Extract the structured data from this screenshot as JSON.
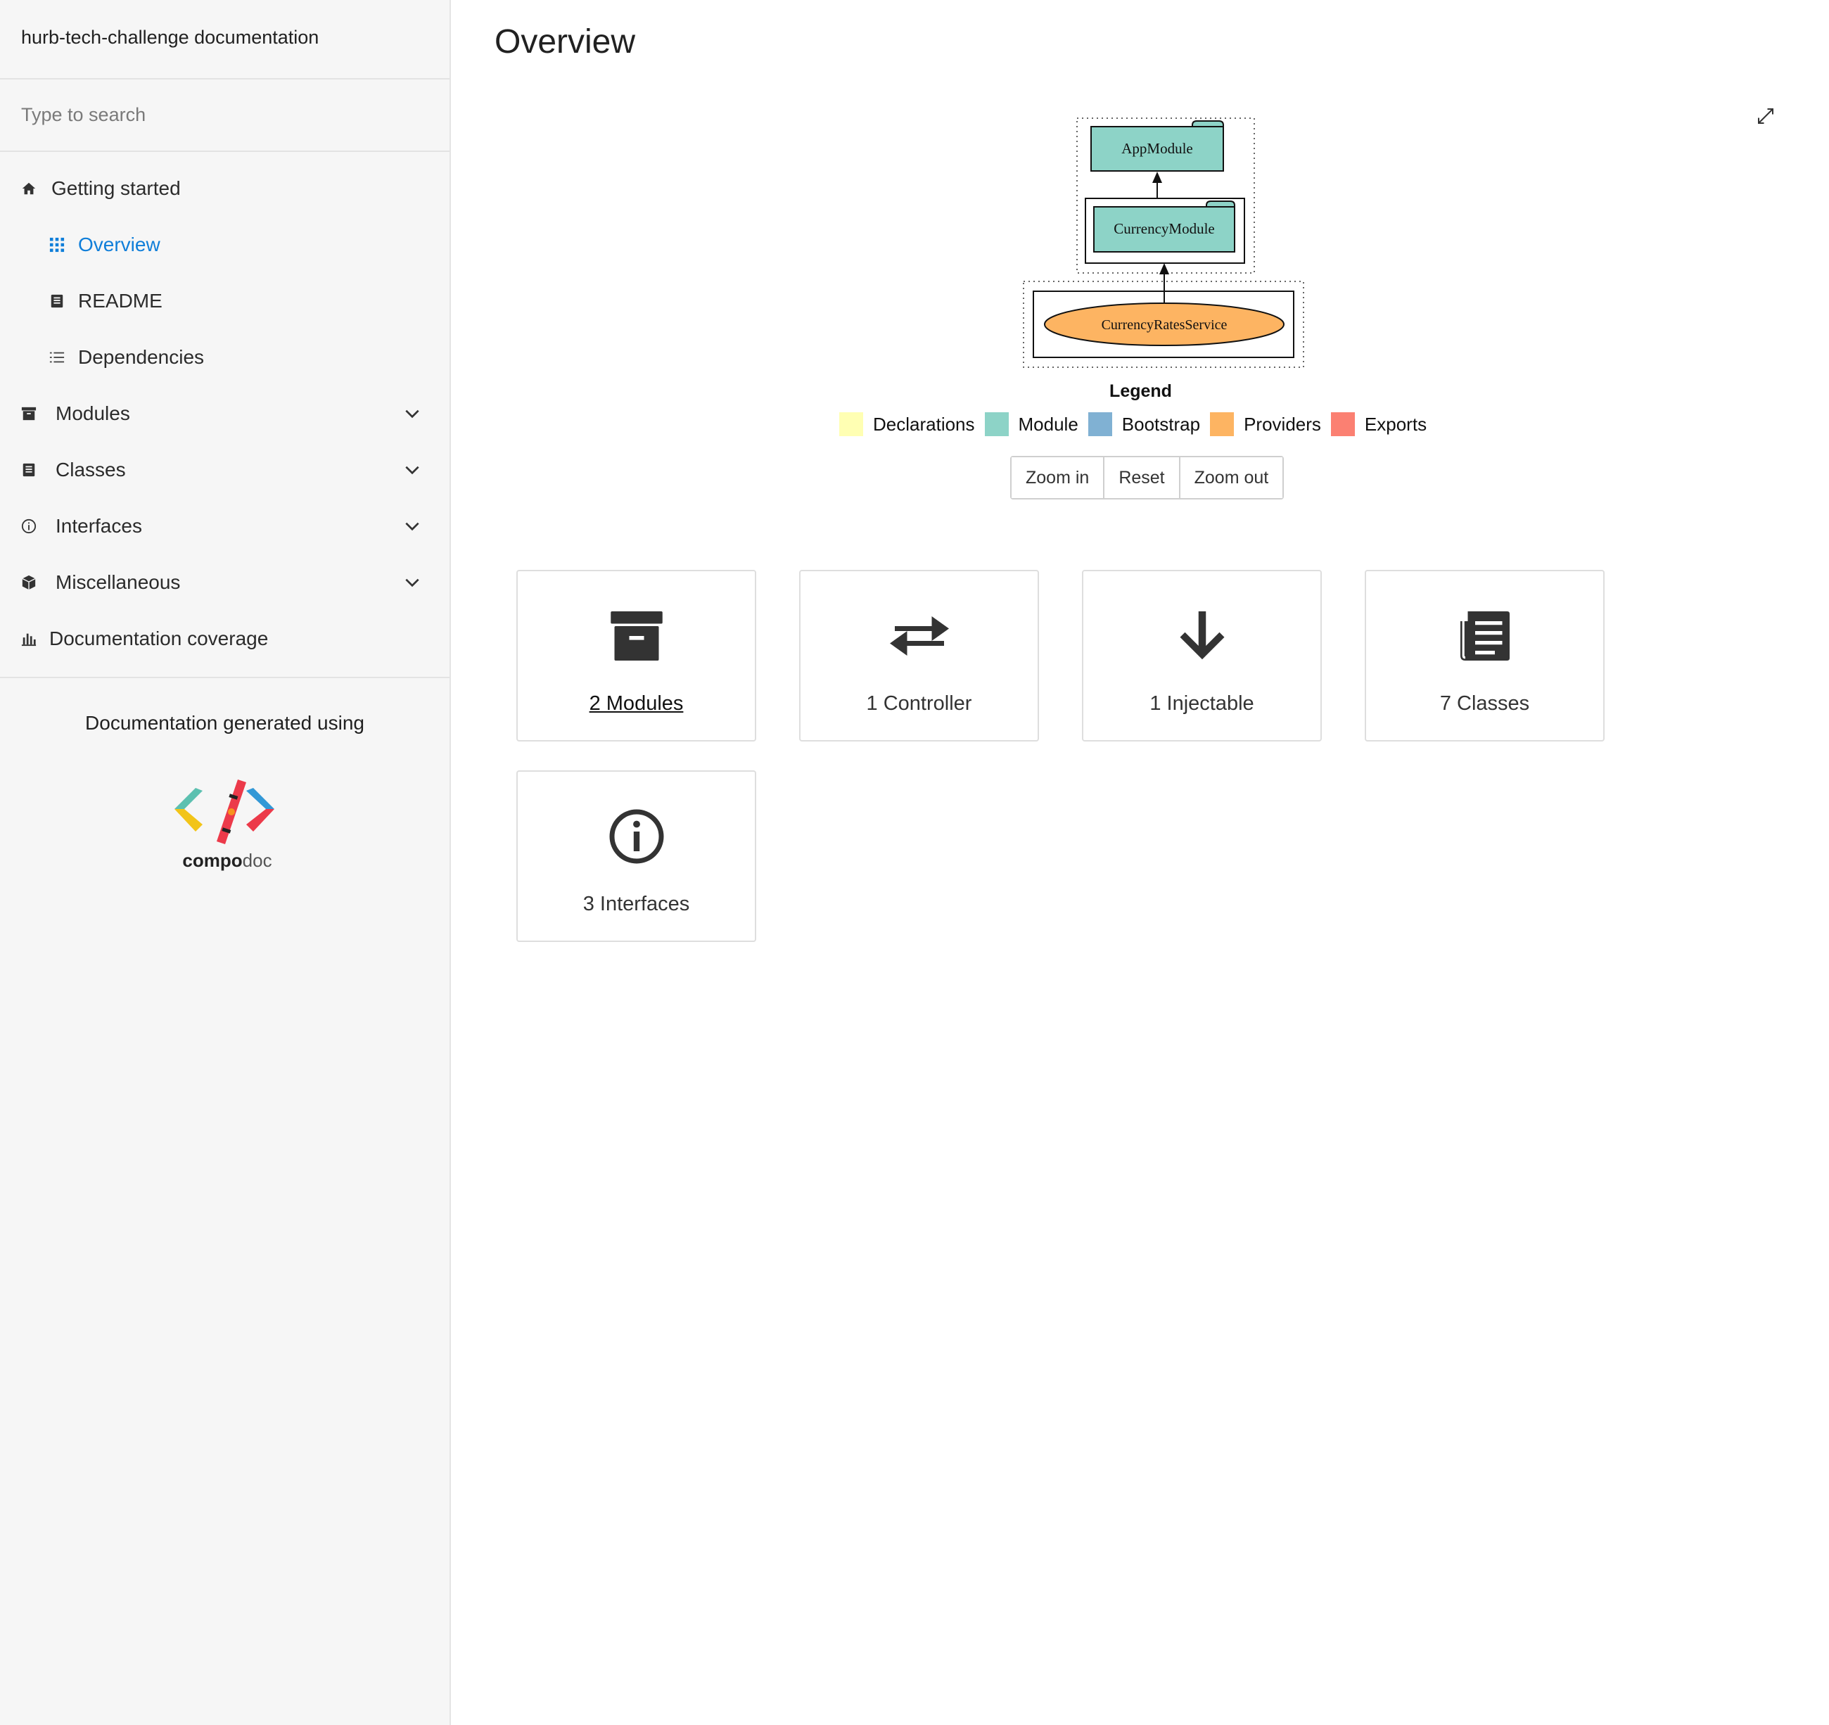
{
  "sidebar": {
    "title": "hurb-tech-challenge documentation",
    "search": {
      "placeholder": "Type to search",
      "value": ""
    },
    "menu": [
      {
        "label": "Getting started",
        "icon": "home-icon"
      },
      {
        "label": "Overview",
        "icon": "grid-icon",
        "active": true
      },
      {
        "label": "README",
        "icon": "book-icon"
      },
      {
        "label": "Dependencies",
        "icon": "list-icon"
      },
      {
        "label": "Modules",
        "icon": "archive-icon"
      },
      {
        "label": "Classes",
        "icon": "file-icon"
      },
      {
        "label": "Interfaces",
        "icon": "info-icon"
      },
      {
        "label": "Miscellaneous",
        "icon": "cube-icon"
      },
      {
        "label": "Documentation coverage",
        "icon": "bar-chart-icon"
      }
    ],
    "generated_using": "Documentation generated using",
    "logo": {
      "text_bold": "compo",
      "text_light": "doc"
    }
  },
  "main": {
    "title": "Overview",
    "graph": {
      "nodes": [
        "AppModule",
        "CurrencyModule",
        "CurrencyRatesService"
      ]
    },
    "legend": {
      "title": "Legend",
      "items": [
        {
          "label": "Declarations",
          "color": "#ffffb3"
        },
        {
          "label": "Module",
          "color": "#8dd3c7"
        },
        {
          "label": "Bootstrap",
          "color": "#80b1d3"
        },
        {
          "label": "Providers",
          "color": "#fdb462"
        },
        {
          "label": "Exports",
          "color": "#fb8072"
        }
      ]
    },
    "zoom": {
      "zoom_in": "Zoom in",
      "reset": "Reset",
      "zoom_out": "Zoom out"
    },
    "cards": [
      {
        "label": "2 Modules",
        "icon": "archive-icon"
      },
      {
        "label": "1 Controller",
        "icon": "exchange-icon"
      },
      {
        "label": "1 Injectable",
        "icon": "arrow-down-icon"
      },
      {
        "label": "7 Classes",
        "icon": "file-text-icon"
      },
      {
        "label": "3 Interfaces",
        "icon": "info-icon"
      }
    ]
  }
}
